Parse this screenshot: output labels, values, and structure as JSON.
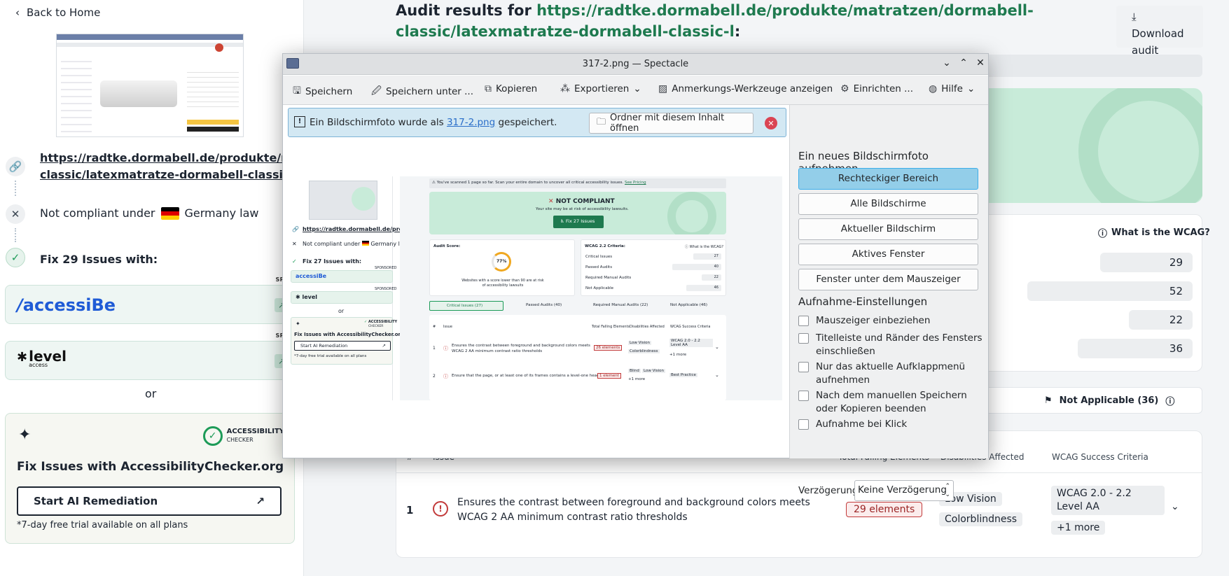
{
  "sidebar": {
    "back_label": "Back to Home",
    "url_line1": "https://radtke.dormabell.de/produkte/matr",
    "url_line2": "classic/latexmatratze-dormabell-classic-l",
    "compliance_text": "Not compliant under",
    "country": "Germany law",
    "fix_title": "Fix 29 Issues with:",
    "sponsored_label": "SPONSO",
    "accessibe_logo": "accessiBe",
    "level_logo": "level",
    "level_logo_sub": "access",
    "or_label": "or",
    "ac_logo_line1": "ACCESSIBILITY",
    "ac_logo_line2": "CHECKER",
    "ac_title": "Fix Issues with AccessibilityChecker.org",
    "ac_button": "Start AI Remediation",
    "ac_note": "*7-day free trial available on all plans"
  },
  "main": {
    "title_prefix": "Audit results for ",
    "title_url": "https://radtke.dormabell.de/produkte/matratzen/dormabell-classic/latexmatratze-dormabell-classic-l",
    "title_suffix": ":",
    "download_label": "Download audit",
    "wcag_link": "What is the WCAG?",
    "counts": [
      "29",
      "52",
      "22",
      "36"
    ],
    "na_tab": "Not Applicable (36)",
    "table_headers": {
      "num": "#",
      "issue": "Issue",
      "failing": "Total Falling Elements",
      "disabilities": "Disabilities Affected",
      "criteria": "WCAG Success Criteria"
    },
    "row": {
      "num": "1",
      "issue": "Ensures the contrast between foreground and background colors meets WCAG 2 AA minimum contrast ratio thresholds",
      "elements": "29 elements",
      "disability1": "Low Vision",
      "disability2": "Colorblindness",
      "criteria1": "WCAG 2.0 - 2.2 Level AA",
      "criteria_more": "+1 more"
    }
  },
  "spectacle": {
    "title": "317-2.png — Spectacle",
    "toolbar": {
      "save": "Speichern",
      "save_as": "Speichern unter ...",
      "copy": "Kopieren",
      "export": "Exportieren",
      "annotate": "Anmerkungs-Werkzeuge anzeigen",
      "configure": "Einrichten ...",
      "help": "Hilfe"
    },
    "message_prefix": "Ein Bildschirmfoto wurde als ",
    "message_file": "317-2.png",
    "message_suffix": " gespeichert.",
    "open_folder": "Ordner mit diesem Inhalt öffnen",
    "new_shot_heading": "Ein neues Bildschirmfoto aufnehmen",
    "modes": [
      "Rechteckiger Bereich",
      "Alle Bildschirme",
      "Aktueller Bildschirm",
      "Aktives Fenster",
      "Fenster unter dem Mauszeiger"
    ],
    "settings_heading": "Aufnahme-Einstellungen",
    "options": [
      "Mauszeiger einbeziehen",
      "Titelleiste und Ränder des Fensters einschließen",
      "Nur das aktuelle Aufklappmenü aufnehmen",
      "Nach dem manuellen Speichern oder Kopieren beenden",
      "Aufnahme bei Klick"
    ],
    "delay_label": "Verzögerung:",
    "delay_value": "Keine Verzögerung"
  },
  "preview": {
    "banner": "You've scanned 1 page so far. Scan your entire domain to uncover all critical accessibility issues.",
    "banner_link": "See Pricing",
    "status": "NOT COMPLIANT",
    "status_sub": "Your site may be at risk of accessibility lawsuits.",
    "fix_button": "Fix 27 Issues",
    "score_label": "Audit Score:",
    "score": "77%",
    "score_note": "Websites with a score lower than 90 are at risk of accessibility lawsuits",
    "criteria_label": "WCAG 2.2 Criteria:",
    "criteria_link": "What is the WCAG?",
    "criteria_rows": [
      {
        "label": "Critical Issues",
        "value": "27"
      },
      {
        "label": "Passed Audits",
        "value": "40"
      },
      {
        "label": "Required Manual Audits",
        "value": "22"
      },
      {
        "label": "Not Applicable",
        "value": "46"
      }
    ],
    "tabs": [
      "Critical Issues (27)",
      "Passed Audits (40)",
      "Required Manual Audits (22)",
      "Not Applicable (46)"
    ],
    "headers": [
      "#",
      "Issue",
      "Total Falling Elements",
      "Disabilities Affected",
      "WCAG Success Criteria"
    ],
    "row1": {
      "num": "1",
      "issue": "Ensures the contrast between foreground and background colors meets WCAG 2 AA minimum contrast ratio thresholds",
      "els": "26 elements",
      "d1": "Low Vision",
      "d2": "Colorblindness",
      "c1": "WCAG 2.0 - 2.2 Level AA",
      "c2": "+1 more"
    },
    "row2": {
      "num": "2",
      "issue": "Ensure that the page, or at least one of its frames contains a level-one heading",
      "els": "1 element",
      "d1": "Blind",
      "d2": "Low Vision",
      "d3": "+1 more",
      "c1": "Best Practice"
    },
    "left_url": "https://radtke.dormabell.de/produkte/matratze",
    "left_compliance": "Not compliant under",
    "left_law": "Germany law",
    "left_fix": "Fix 27 Issues with:",
    "left_sponsored": "SPONSORED",
    "left_accessibe": "accessiBe",
    "left_level": "level",
    "left_or": "or",
    "left_ac_title": "Fix Issues with AccessibilityChecker.org",
    "left_ac_logo": "ACCESSIBILITY",
    "left_ac_logo2": "CHECKER",
    "left_ac_btn": "Start AI Remediation",
    "left_ac_note": "*7-day free trial available on all plans"
  }
}
